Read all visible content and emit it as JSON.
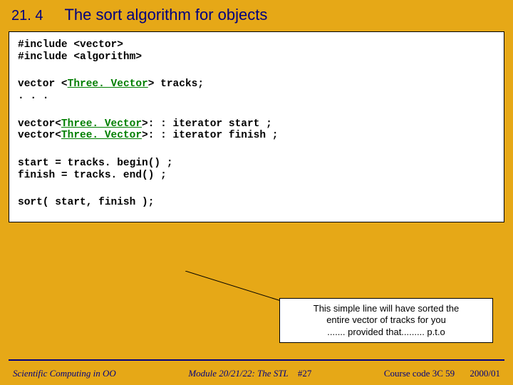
{
  "header": {
    "section": "21. 4",
    "title": "The sort algorithm for objects"
  },
  "code": {
    "block1_line1": "#include <vector>",
    "block1_line2": "#include <algorithm>",
    "block2_pre": "vector <",
    "block2_tv": "Three. Vector",
    "block2_post": "> tracks;",
    "block2_dots": ". . .",
    "block3_l1_pre": "vector<",
    "block3_l1_tv": "Three. Vector",
    "block3_l1_post": ">: : iterator start ;",
    "block3_l2_pre": "vector<",
    "block3_l2_tv": "Three. Vector",
    "block3_l2_post": ">: : iterator finish ;",
    "block4_l1": "start  = tracks. begin() ;",
    "block4_l2": "finish = tracks. end() ;",
    "block5": "sort( start, finish );"
  },
  "callout": {
    "line1": "This simple line will have sorted the",
    "line2": "entire vector of tracks for you",
    "line3": "....... provided that......... p.t.o"
  },
  "footer": {
    "left": "Scientific Computing in OO",
    "center_module": "Module 20/21/22: The STL",
    "center_page": "#27",
    "right_course": "Course code 3C 59",
    "right_year": "2000/01"
  }
}
